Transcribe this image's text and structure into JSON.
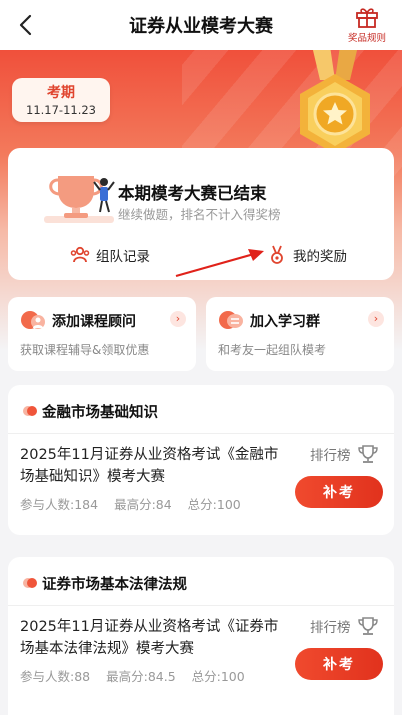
{
  "header": {
    "title": "证券从业模考大赛",
    "rules_label": "奖品规则"
  },
  "period": {
    "label": "考期",
    "dates": "11.17-11.23"
  },
  "status": {
    "title": "本期模考大赛已结束",
    "subtitle": "继续做题，排名不计入得奖榜",
    "team_record": "组队记录",
    "my_rewards": "我的奖励"
  },
  "promos": [
    {
      "title": "添加课程顾问",
      "desc": "获取课程辅导&领取优惠"
    },
    {
      "title": "加入学习群",
      "desc": "和考友一起组队模考"
    }
  ],
  "exams": [
    {
      "category": "金融市场基础知识",
      "name": "2025年11月证券从业资格考试《金融市场基础知识》模考大赛",
      "rank_label": "排行榜",
      "participants": "参与人数:184",
      "max_score": "最高分:84",
      "total": "总分:100",
      "button": "补考"
    },
    {
      "category": "证券市场基本法律法规",
      "name": "2025年11月证券从业资格考试《证券市场基本法律法规》模考大赛",
      "rank_label": "排行榜",
      "participants": "参与人数:88",
      "max_score": "最高分:84.5",
      "total": "总分:100",
      "button": "补考"
    }
  ],
  "colors": {
    "accent": "#e0452f",
    "brand_red": "#f0503b"
  }
}
